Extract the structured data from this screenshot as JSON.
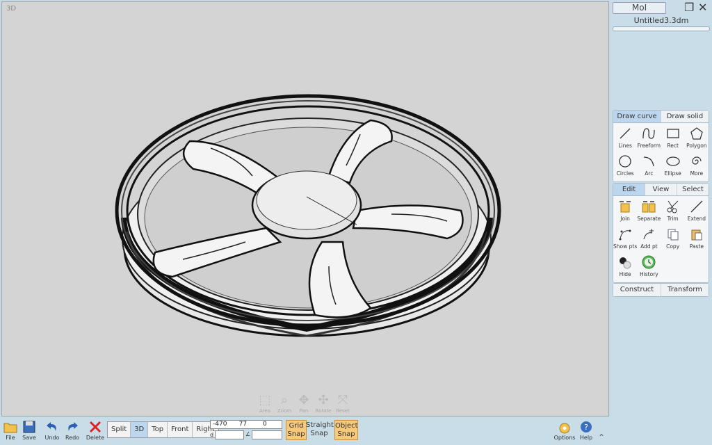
{
  "app": {
    "title": "MoI",
    "document": "Untitled3.3dm"
  },
  "viewport": {
    "label": "3D",
    "tools": [
      {
        "name": "area",
        "label": "Area"
      },
      {
        "name": "zoom",
        "label": "Zoom"
      },
      {
        "name": "pan",
        "label": "Pan"
      },
      {
        "name": "rotate",
        "label": "Rotate"
      },
      {
        "name": "reset",
        "label": "Reset"
      }
    ]
  },
  "draw_panel": {
    "tabs": [
      "Draw curve",
      "Draw solid"
    ],
    "active_tab": 0,
    "items": [
      "Lines",
      "Freeform",
      "Rect",
      "Polygon",
      "Circles",
      "Arc",
      "Ellipse",
      "More"
    ]
  },
  "edit_panel": {
    "tabs": [
      "Edit",
      "View",
      "Select"
    ],
    "active_tab": 0,
    "items": [
      "Join",
      "Separate",
      "Trim",
      "Extend",
      "Show pts",
      "Add pt",
      "Copy",
      "Paste",
      "Hide",
      "History"
    ]
  },
  "construct_panel": {
    "tabs": [
      "Construct",
      "Transform"
    ]
  },
  "bottom": {
    "file": "File",
    "save": "Save",
    "undo": "Undo",
    "redo": "Redo",
    "delete": "Delete",
    "views": [
      "Split",
      "3D",
      "Top",
      "Front",
      "Right"
    ],
    "active_view": 1,
    "coords": {
      "x": "-470",
      "y": "77",
      "z": "0",
      "d_label": "d",
      "angle_label": "∠"
    },
    "grid_snap": "Grid\nSnap",
    "straight_snap": "Straight\nSnap",
    "object_snap": "Object\nSnap",
    "options": "Options",
    "help": "Help"
  },
  "colors": {
    "accent": "#bcd6ee",
    "snap_on": "#f7c97a",
    "viewport_bg": "#d4d4d4"
  }
}
